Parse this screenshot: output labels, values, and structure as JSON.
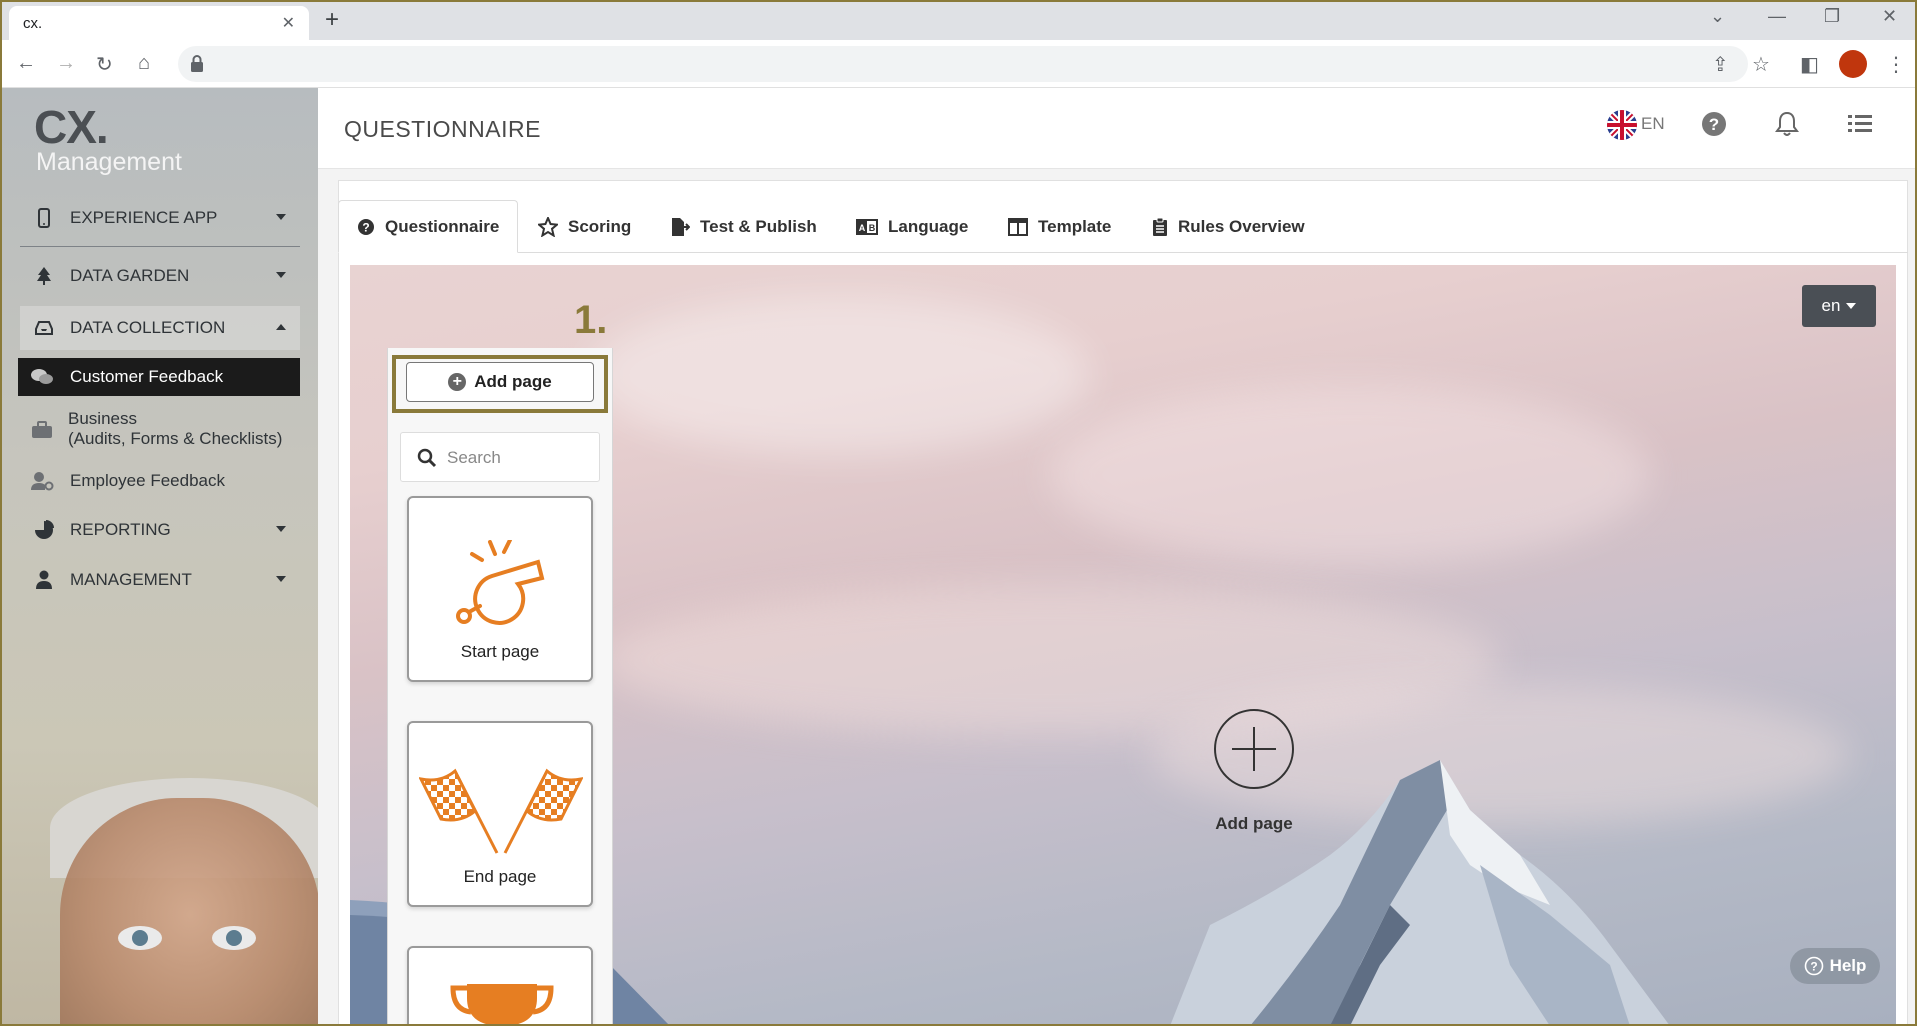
{
  "browser": {
    "tab_title": "cx.",
    "tab_close": "✕",
    "new_tab": "+"
  },
  "logo": {
    "brand": "CX.",
    "subtitle": "Management"
  },
  "sidebar": {
    "items": [
      {
        "label": "EXPERIENCE APP"
      },
      {
        "label": "DATA GARDEN"
      },
      {
        "label": "DATA COLLECTION"
      },
      {
        "label": "REPORTING"
      },
      {
        "label": "MANAGEMENT"
      }
    ],
    "sub_items": [
      {
        "label": "Customer Feedback"
      },
      {
        "label_line1": "Business",
        "label_line2": "(Audits, Forms & Checklists)"
      },
      {
        "label": "Employee Feedback"
      }
    ]
  },
  "header": {
    "title": "QUESTIONNAIRE",
    "language": "EN"
  },
  "tabs": [
    {
      "label": "Questionnaire",
      "icon": "question-circle-icon"
    },
    {
      "label": "Scoring",
      "icon": "star-icon"
    },
    {
      "label": "Test & Publish",
      "icon": "file-export-icon"
    },
    {
      "label": "Language",
      "icon": "language-icon"
    },
    {
      "label": "Template",
      "icon": "columns-icon"
    },
    {
      "label": "Rules Overview",
      "icon": "clipboard-list-icon"
    }
  ],
  "palette": {
    "step": "1.",
    "add_page": "Add page",
    "search_placeholder": "Search",
    "tiles": [
      {
        "label": "Start page",
        "icon": "whistle-icon"
      },
      {
        "label": "End page",
        "icon": "checkered-flags-icon"
      },
      {
        "label": "",
        "icon": "trophy-icon"
      }
    ]
  },
  "canvas": {
    "language_select": "en",
    "add_page_label": "Add page",
    "help_label": "Help"
  },
  "colors": {
    "accent": "#e67e22",
    "highlight": "#8a7a3a",
    "active_nav": "#1b1b1b"
  }
}
